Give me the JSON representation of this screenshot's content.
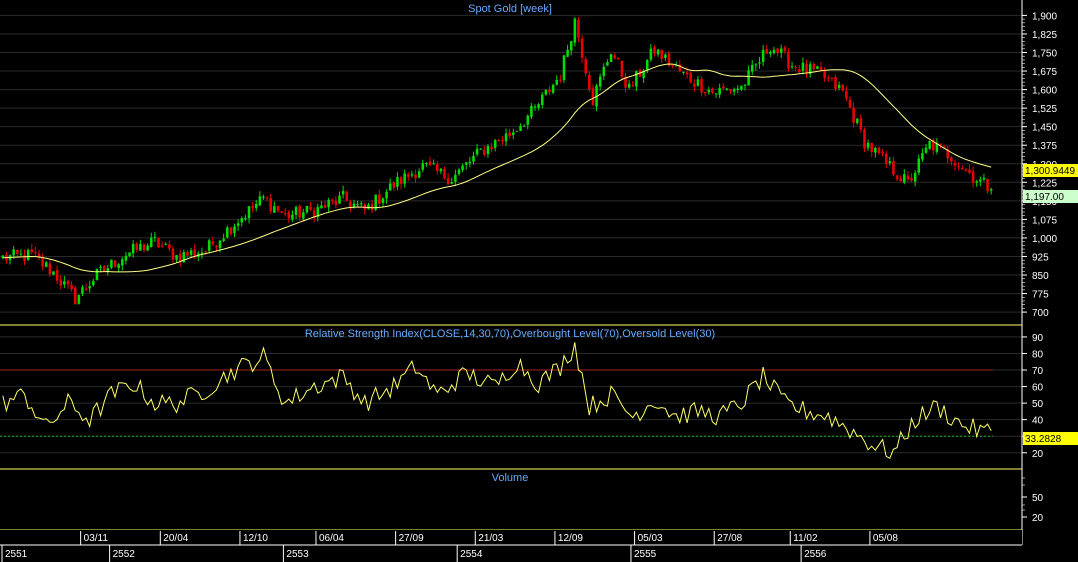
{
  "colors": {
    "background": "#000000",
    "up_candle": "#00dd00",
    "down_candle": "#ee0000",
    "ma_line": "#ffff88",
    "rsi_line": "#ffff66",
    "overbought_line": "#aa2222",
    "oversold_line": "#22aa22",
    "panel_border": "#ffff66",
    "title": "#66aaff",
    "price_badge": "#ffff00",
    "close_badge": "#ccffcc"
  },
  "chart_data": [
    {
      "type": "candlestick",
      "title": "Spot Gold [week]",
      "ylim": [
        660,
        1930
      ],
      "yticks": [
        700,
        775,
        850,
        925,
        1000,
        1075,
        1150,
        1225,
        1300,
        1375,
        1450,
        1525,
        1600,
        1675,
        1750,
        1825,
        1900
      ],
      "ytick_labels": [
        "700",
        "775",
        "850",
        "925",
        "1,000",
        "1,075",
        "1,150",
        "1,225",
        "1,300",
        "1,375",
        "1,450",
        "1,525",
        "1,600",
        "1,675",
        "1,750",
        "1,825",
        "1,900"
      ],
      "moving_average_last": "1,300.9449",
      "close_last": "1,197.00",
      "close_anchors": [
        [
          0,
          920
        ],
        [
          8,
          930
        ],
        [
          14,
          860
        ],
        [
          20,
          755
        ],
        [
          26,
          850
        ],
        [
          34,
          935
        ],
        [
          42,
          985
        ],
        [
          48,
          925
        ],
        [
          56,
          950
        ],
        [
          64,
          1060
        ],
        [
          72,
          1160
        ],
        [
          78,
          1090
        ],
        [
          86,
          1110
        ],
        [
          94,
          1160
        ],
        [
          100,
          1110
        ],
        [
          108,
          1215
        ],
        [
          116,
          1290
        ],
        [
          124,
          1240
        ],
        [
          132,
          1350
        ],
        [
          140,
          1420
        ],
        [
          147,
          1520
        ],
        [
          154,
          1660
        ],
        [
          158,
          1880
        ],
        [
          163,
          1560
        ],
        [
          168,
          1760
        ],
        [
          173,
          1600
        ],
        [
          180,
          1760
        ],
        [
          188,
          1660
        ],
        [
          196,
          1590
        ],
        [
          204,
          1610
        ],
        [
          212,
          1780
        ],
        [
          218,
          1700
        ],
        [
          226,
          1660
        ],
        [
          232,
          1590
        ],
        [
          238,
          1390
        ],
        [
          244,
          1300
        ],
        [
          250,
          1220
        ],
        [
          256,
          1380
        ],
        [
          262,
          1330
        ],
        [
          268,
          1250
        ],
        [
          273,
          1197
        ]
      ]
    },
    {
      "type": "line",
      "title": "Relative Strength Index(CLOSE,14,30,70),Overbought Level(70),Oversold Level(30)",
      "ylim": [
        12,
        96
      ],
      "yticks": [
        20,
        30,
        40,
        50,
        60,
        70,
        80,
        90
      ],
      "ytick_labels": [
        "20",
        "30",
        "40",
        "50",
        "60",
        "70",
        "80",
        "90"
      ],
      "overbought": 70,
      "oversold": 30,
      "last_value": "33.2828",
      "rsi_anchors": [
        [
          0,
          50
        ],
        [
          6,
          55
        ],
        [
          12,
          35
        ],
        [
          18,
          50
        ],
        [
          24,
          40
        ],
        [
          30,
          55
        ],
        [
          36,
          62
        ],
        [
          42,
          50
        ],
        [
          48,
          50
        ],
        [
          56,
          58
        ],
        [
          64,
          70
        ],
        [
          72,
          78
        ],
        [
          78,
          50
        ],
        [
          86,
          60
        ],
        [
          94,
          66
        ],
        [
          100,
          50
        ],
        [
          108,
          60
        ],
        [
          114,
          72
        ],
        [
          120,
          55
        ],
        [
          128,
          68
        ],
        [
          136,
          60
        ],
        [
          142,
          75
        ],
        [
          148,
          62
        ],
        [
          154,
          72
        ],
        [
          158,
          85
        ],
        [
          162,
          48
        ],
        [
          168,
          55
        ],
        [
          174,
          42
        ],
        [
          180,
          52
        ],
        [
          186,
          42
        ],
        [
          192,
          45
        ],
        [
          198,
          42
        ],
        [
          204,
          50
        ],
        [
          210,
          66
        ],
        [
          216,
          50
        ],
        [
          222,
          45
        ],
        [
          228,
          42
        ],
        [
          234,
          34
        ],
        [
          240,
          25
        ],
        [
          246,
          20
        ],
        [
          252,
          40
        ],
        [
          258,
          48
        ],
        [
          264,
          38
        ],
        [
          270,
          33
        ]
      ]
    },
    {
      "type": "bar",
      "title": "Volume",
      "yticks": [
        20,
        50
      ],
      "ytick_labels": [
        "20",
        "50"
      ]
    }
  ],
  "x_axis": {
    "num_bars": 274,
    "date_ticks": [
      {
        "bar": 22,
        "label": "03/11"
      },
      {
        "bar": 44,
        "label": "20/04"
      },
      {
        "bar": 66,
        "label": "12/10"
      },
      {
        "bar": 87,
        "label": "06/04"
      },
      {
        "bar": 109,
        "label": "27/09"
      },
      {
        "bar": 131,
        "label": "21/03"
      },
      {
        "bar": 153,
        "label": "12/09"
      },
      {
        "bar": 175,
        "label": "05/03"
      },
      {
        "bar": 197,
        "label": "27/08"
      },
      {
        "bar": 218,
        "label": "11/02"
      },
      {
        "bar": 240,
        "label": "05/08"
      }
    ],
    "year_ticks": [
      {
        "bar": 0,
        "label": "2551"
      },
      {
        "bar": 30,
        "label": "2552"
      },
      {
        "bar": 78,
        "label": "2553"
      },
      {
        "bar": 126,
        "label": "2554"
      },
      {
        "bar": 174,
        "label": "2555"
      },
      {
        "bar": 221,
        "label": "2556"
      }
    ]
  }
}
